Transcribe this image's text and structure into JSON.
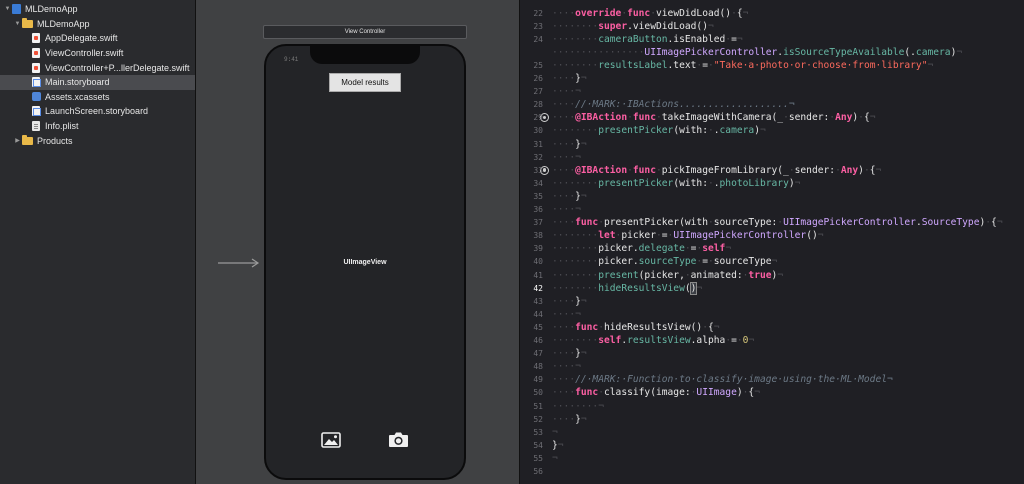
{
  "navigator": {
    "items": [
      {
        "label": "MLDemoApp",
        "level": 0,
        "icon": "project-icon",
        "disclosure": "expanded",
        "selected": false
      },
      {
        "label": "MLDemoApp",
        "level": 1,
        "icon": "folder-icon",
        "disclosure": "expanded",
        "selected": false
      },
      {
        "label": "AppDelegate.swift",
        "level": 2,
        "icon": "swift-file-icon",
        "disclosure": "none",
        "selected": false
      },
      {
        "label": "ViewController.swift",
        "level": 2,
        "icon": "swift-file-icon",
        "disclosure": "none",
        "selected": false
      },
      {
        "label": "ViewController+P...llerDelegate.swift",
        "level": 2,
        "icon": "swift-file-icon",
        "disclosure": "none",
        "selected": false
      },
      {
        "label": "Main.storyboard",
        "level": 2,
        "icon": "storyboard-file-icon",
        "disclosure": "none",
        "selected": true
      },
      {
        "label": "Assets.xcassets",
        "level": 2,
        "icon": "assets-icon",
        "disclosure": "none",
        "selected": false
      },
      {
        "label": "LaunchScreen.storyboard",
        "level": 2,
        "icon": "storyboard-file-icon",
        "disclosure": "none",
        "selected": false
      },
      {
        "label": "Info.plist",
        "level": 2,
        "icon": "plist-file-icon",
        "disclosure": "none",
        "selected": false
      },
      {
        "label": "Products",
        "level": 1,
        "icon": "folder-icon",
        "disclosure": "collapsed",
        "selected": false
      }
    ]
  },
  "canvas": {
    "scene_title": "View Controller",
    "status_time": "9:41",
    "results_button_label": "Model results",
    "image_view_label": "UIImageView",
    "photo_library_icon": "photo-icon",
    "camera_icon": "camera-icon"
  },
  "editor": {
    "current_line": 42,
    "colors": {
      "keyword": "#fc5fa3",
      "type": "#d0a8ff",
      "function": "#67b7a4",
      "string": "#fc6a5d",
      "comment": "#6c7986"
    },
    "lines": [
      {
        "n": 22,
        "mark": false,
        "tokens": [
          [
            "w",
            "····"
          ],
          [
            "k",
            "override"
          ],
          [
            "w",
            "·"
          ],
          [
            "k",
            "func"
          ],
          [
            "w",
            "·"
          ],
          [
            "",
            "viewDidLoad()"
          ],
          [
            "w",
            "·"
          ],
          [
            "",
            "{"
          ],
          [
            "w",
            "¬"
          ]
        ]
      },
      {
        "n": 23,
        "mark": false,
        "tokens": [
          [
            "w",
            "········"
          ],
          [
            "k",
            "super"
          ],
          [
            "",
            ".viewDidLoad()"
          ],
          [
            "w",
            "¬"
          ]
        ]
      },
      {
        "n": 24,
        "mark": false,
        "tokens": [
          [
            "w",
            "········"
          ],
          [
            "f",
            "cameraButton"
          ],
          [
            "",
            ".isEnabled"
          ],
          [
            "w",
            "·"
          ],
          [
            "",
            "="
          ],
          [
            "w",
            "¬"
          ]
        ]
      },
      {
        "n": null,
        "mark": false,
        "tokens": [
          [
            "w",
            "················"
          ],
          [
            "t",
            "UIImagePickerController"
          ],
          [
            "",
            "."
          ],
          [
            "f",
            "isSourceTypeAvailable"
          ],
          [
            "",
            "(."
          ],
          [
            "f",
            "camera"
          ],
          [
            "",
            ")"
          ],
          [
            "w",
            "¬"
          ]
        ]
      },
      {
        "n": 25,
        "mark": false,
        "tokens": [
          [
            "w",
            "········"
          ],
          [
            "f",
            "resultsLabel"
          ],
          [
            "",
            ".text"
          ],
          [
            "w",
            "·"
          ],
          [
            "",
            "="
          ],
          [
            "w",
            "·"
          ],
          [
            "s",
            "\"Take·a·photo·or·choose·from·library\""
          ],
          [
            "w",
            "¬"
          ]
        ]
      },
      {
        "n": 26,
        "mark": false,
        "tokens": [
          [
            "w",
            "····"
          ],
          [
            "",
            "}"
          ],
          [
            "w",
            "¬"
          ]
        ]
      },
      {
        "n": 27,
        "mark": false,
        "tokens": [
          [
            "w",
            "····¬"
          ]
        ]
      },
      {
        "n": 28,
        "mark": false,
        "tokens": [
          [
            "w",
            "····"
          ],
          [
            "c",
            "//·MARK:·IBActions...................¬"
          ]
        ]
      },
      {
        "n": 29,
        "mark": true,
        "tokens": [
          [
            "w",
            "····"
          ],
          [
            "k",
            "@IBAction"
          ],
          [
            "w",
            "·"
          ],
          [
            "k",
            "func"
          ],
          [
            "w",
            "·"
          ],
          [
            "",
            "takeImageWithCamera(_"
          ],
          [
            "w",
            "·"
          ],
          [
            "",
            "sender:"
          ],
          [
            "w",
            "·"
          ],
          [
            "k",
            "Any"
          ],
          [
            "",
            ")"
          ],
          [
            "w",
            "·"
          ],
          [
            "",
            "{"
          ],
          [
            "w",
            "¬"
          ]
        ]
      },
      {
        "n": 30,
        "mark": false,
        "tokens": [
          [
            "w",
            "········"
          ],
          [
            "f",
            "presentPicker"
          ],
          [
            "",
            "(with:"
          ],
          [
            "w",
            "·"
          ],
          [
            "",
            "."
          ],
          [
            "f",
            "camera"
          ],
          [
            "",
            ")"
          ],
          [
            "w",
            "¬"
          ]
        ]
      },
      {
        "n": 31,
        "mark": false,
        "tokens": [
          [
            "w",
            "····"
          ],
          [
            "",
            "}"
          ],
          [
            "w",
            "¬"
          ]
        ]
      },
      {
        "n": 32,
        "mark": false,
        "tokens": [
          [
            "w",
            "····¬"
          ]
        ]
      },
      {
        "n": 33,
        "mark": true,
        "tokens": [
          [
            "w",
            "····"
          ],
          [
            "k",
            "@IBAction"
          ],
          [
            "w",
            "·"
          ],
          [
            "k",
            "func"
          ],
          [
            "w",
            "·"
          ],
          [
            "",
            "pickImageFromLibrary(_"
          ],
          [
            "w",
            "·"
          ],
          [
            "",
            "sender:"
          ],
          [
            "w",
            "·"
          ],
          [
            "k",
            "Any"
          ],
          [
            "",
            ")"
          ],
          [
            "w",
            "·"
          ],
          [
            "",
            "{"
          ],
          [
            "w",
            "¬"
          ]
        ]
      },
      {
        "n": 34,
        "mark": false,
        "tokens": [
          [
            "w",
            "········"
          ],
          [
            "f",
            "presentPicker"
          ],
          [
            "",
            "(with:"
          ],
          [
            "w",
            "·"
          ],
          [
            "",
            "."
          ],
          [
            "f",
            "photoLibrary"
          ],
          [
            "",
            ")"
          ],
          [
            "w",
            "¬"
          ]
        ]
      },
      {
        "n": 35,
        "mark": false,
        "tokens": [
          [
            "w",
            "····"
          ],
          [
            "",
            "}"
          ],
          [
            "w",
            "¬"
          ]
        ]
      },
      {
        "n": 36,
        "mark": false,
        "tokens": [
          [
            "w",
            "····¬"
          ]
        ]
      },
      {
        "n": 37,
        "mark": false,
        "tokens": [
          [
            "w",
            "····"
          ],
          [
            "k",
            "func"
          ],
          [
            "w",
            "·"
          ],
          [
            "",
            "presentPicker(with"
          ],
          [
            "w",
            "·"
          ],
          [
            "",
            "sourceType:"
          ],
          [
            "w",
            "·"
          ],
          [
            "t",
            "UIImagePickerController"
          ],
          [
            "",
            "."
          ],
          [
            "t",
            "SourceType"
          ],
          [
            "",
            ")"
          ],
          [
            "w",
            "·"
          ],
          [
            "",
            "{"
          ],
          [
            "w",
            "¬"
          ]
        ]
      },
      {
        "n": 38,
        "mark": false,
        "tokens": [
          [
            "w",
            "········"
          ],
          [
            "k",
            "let"
          ],
          [
            "w",
            "·"
          ],
          [
            "",
            "picker"
          ],
          [
            "w",
            "·"
          ],
          [
            "",
            "="
          ],
          [
            "w",
            "·"
          ],
          [
            "t",
            "UIImagePickerController"
          ],
          [
            "",
            "()"
          ],
          [
            "w",
            "¬"
          ]
        ]
      },
      {
        "n": 39,
        "mark": false,
        "tokens": [
          [
            "w",
            "········"
          ],
          [
            "",
            "picker."
          ],
          [
            "f",
            "delegate"
          ],
          [
            "w",
            "·"
          ],
          [
            "",
            "="
          ],
          [
            "w",
            "·"
          ],
          [
            "k",
            "self"
          ],
          [
            "w",
            "¬"
          ]
        ]
      },
      {
        "n": 40,
        "mark": false,
        "tokens": [
          [
            "w",
            "········"
          ],
          [
            "",
            "picker."
          ],
          [
            "f",
            "sourceType"
          ],
          [
            "w",
            "·"
          ],
          [
            "",
            "="
          ],
          [
            "w",
            "·"
          ],
          [
            "",
            "sourceType"
          ],
          [
            "w",
            "¬"
          ]
        ]
      },
      {
        "n": 41,
        "mark": false,
        "tokens": [
          [
            "w",
            "········"
          ],
          [
            "f",
            "present"
          ],
          [
            "",
            "(picker,"
          ],
          [
            "w",
            "·"
          ],
          [
            "",
            "animated:"
          ],
          [
            "w",
            "·"
          ],
          [
            "k",
            "true"
          ],
          [
            "",
            ")"
          ],
          [
            "w",
            "¬"
          ]
        ]
      },
      {
        "n": 42,
        "mark": false,
        "tokens": [
          [
            "w",
            "········"
          ],
          [
            "f",
            "hideResultsView"
          ],
          [
            "",
            "("
          ],
          [
            "caret",
            ")"
          ],
          [
            "w",
            "¬"
          ]
        ]
      },
      {
        "n": 43,
        "mark": false,
        "tokens": [
          [
            "w",
            "····"
          ],
          [
            "",
            "}"
          ],
          [
            "w",
            "¬"
          ]
        ]
      },
      {
        "n": 44,
        "mark": false,
        "tokens": [
          [
            "w",
            "····¬"
          ]
        ]
      },
      {
        "n": 45,
        "mark": false,
        "tokens": [
          [
            "w",
            "····"
          ],
          [
            "k",
            "func"
          ],
          [
            "w",
            "·"
          ],
          [
            "",
            "hideResultsView()"
          ],
          [
            "w",
            "·"
          ],
          [
            "",
            "{"
          ],
          [
            "w",
            "¬"
          ]
        ]
      },
      {
        "n": 46,
        "mark": false,
        "tokens": [
          [
            "w",
            "········"
          ],
          [
            "k",
            "self"
          ],
          [
            "",
            "."
          ],
          [
            "f",
            "resultsView"
          ],
          [
            "",
            ".alpha"
          ],
          [
            "w",
            "·"
          ],
          [
            "",
            "="
          ],
          [
            "w",
            "·"
          ],
          [
            "n",
            "0"
          ],
          [
            "w",
            "¬"
          ]
        ]
      },
      {
        "n": 47,
        "mark": false,
        "tokens": [
          [
            "w",
            "····"
          ],
          [
            "",
            "}"
          ],
          [
            "w",
            "¬"
          ]
        ]
      },
      {
        "n": 48,
        "mark": false,
        "tokens": [
          [
            "w",
            "····¬"
          ]
        ]
      },
      {
        "n": 49,
        "mark": false,
        "tokens": [
          [
            "w",
            "····"
          ],
          [
            "c",
            "//·MARK:·Function·to·classify·image·using·the·ML·Model¬"
          ]
        ]
      },
      {
        "n": 50,
        "mark": false,
        "tokens": [
          [
            "w",
            "····"
          ],
          [
            "k",
            "func"
          ],
          [
            "w",
            "·"
          ],
          [
            "",
            "classify(image:"
          ],
          [
            "w",
            "·"
          ],
          [
            "t",
            "UIImage"
          ],
          [
            "",
            ")"
          ],
          [
            "w",
            "·"
          ],
          [
            "",
            "{"
          ],
          [
            "w",
            "¬"
          ]
        ]
      },
      {
        "n": 51,
        "mark": false,
        "tokens": [
          [
            "w",
            "········¬"
          ]
        ]
      },
      {
        "n": 52,
        "mark": false,
        "tokens": [
          [
            "w",
            "····"
          ],
          [
            "",
            "}"
          ],
          [
            "w",
            "¬"
          ]
        ]
      },
      {
        "n": 53,
        "mark": false,
        "tokens": [
          [
            "w",
            "¬"
          ]
        ]
      },
      {
        "n": 54,
        "mark": false,
        "tokens": [
          [
            "",
            "}"
          ],
          [
            "w",
            "¬"
          ]
        ]
      },
      {
        "n": 55,
        "mark": false,
        "tokens": [
          [
            "w",
            "¬"
          ]
        ]
      },
      {
        "n": 56,
        "mark": false,
        "tokens": []
      }
    ]
  }
}
